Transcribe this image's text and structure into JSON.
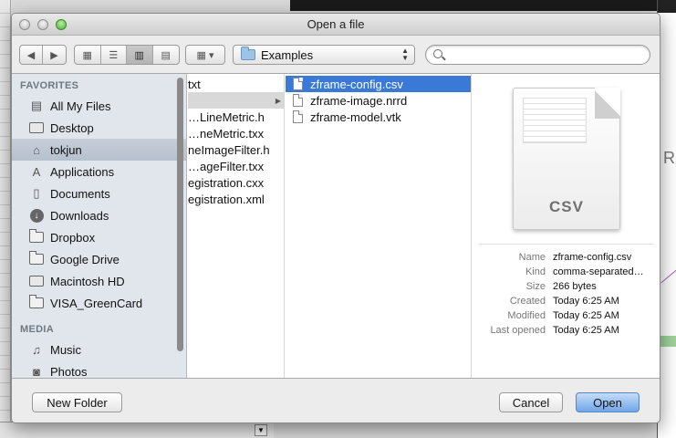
{
  "window": {
    "title": "Open a file"
  },
  "toolbar": {
    "back_icon": "chevron-left-icon",
    "forward_icon": "chevron-right-icon",
    "view_modes": [
      "icon-view",
      "list-view",
      "column-view",
      "coverflow-view"
    ],
    "active_view": "column-view",
    "location": "Examples",
    "search_placeholder": ""
  },
  "sidebar": {
    "favorites_header": "FAVORITES",
    "favorites": [
      {
        "label": "All My Files",
        "icon": "all-files-icon"
      },
      {
        "label": "Desktop",
        "icon": "desktop-icon"
      },
      {
        "label": "tokjun",
        "icon": "home-icon",
        "selected": true
      },
      {
        "label": "Applications",
        "icon": "applications-icon"
      },
      {
        "label": "Documents",
        "icon": "documents-icon"
      },
      {
        "label": "Downloads",
        "icon": "downloads-icon"
      },
      {
        "label": "Dropbox",
        "icon": "folder-icon"
      },
      {
        "label": "Google Drive",
        "icon": "folder-icon"
      },
      {
        "label": "Macintosh HD",
        "icon": "disk-icon"
      },
      {
        "label": "VISA_GreenCard",
        "icon": "folder-icon"
      }
    ],
    "media_header": "MEDIA",
    "media": [
      {
        "label": "Music",
        "icon": "music-icon"
      },
      {
        "label": "Photos",
        "icon": "camera-icon"
      }
    ]
  },
  "columns": {
    "col1": [
      "txt",
      "",
      "…LineMetric.h",
      "…neMetric.txx",
      "neImageFilter.h",
      "…ageFilter.txx",
      "egistration.cxx",
      "egistration.xml"
    ],
    "col2": [
      "zframe-config.csv",
      "zframe-image.nrrd",
      "zframe-model.vtk"
    ]
  },
  "preview": {
    "file_type_label": "CSV",
    "info": [
      {
        "key": "Name",
        "value": "zframe-config.csv"
      },
      {
        "key": "Kind",
        "value": "comma-separated…"
      },
      {
        "key": "Size",
        "value": "266 bytes"
      },
      {
        "key": "Created",
        "value": "Today 6:25 AM"
      },
      {
        "key": "Modified",
        "value": "Today 6:25 AM"
      },
      {
        "key": "Last opened",
        "value": "Today 6:25 AM"
      }
    ]
  },
  "footer": {
    "new_folder_label": "New Folder",
    "cancel_label": "Cancel",
    "open_label": "Open"
  },
  "colors": {
    "selection_blue": "#3a7ad6",
    "sidebar_bg": "#e1e6ed",
    "sidebar_selected": "#bcc5d2"
  }
}
